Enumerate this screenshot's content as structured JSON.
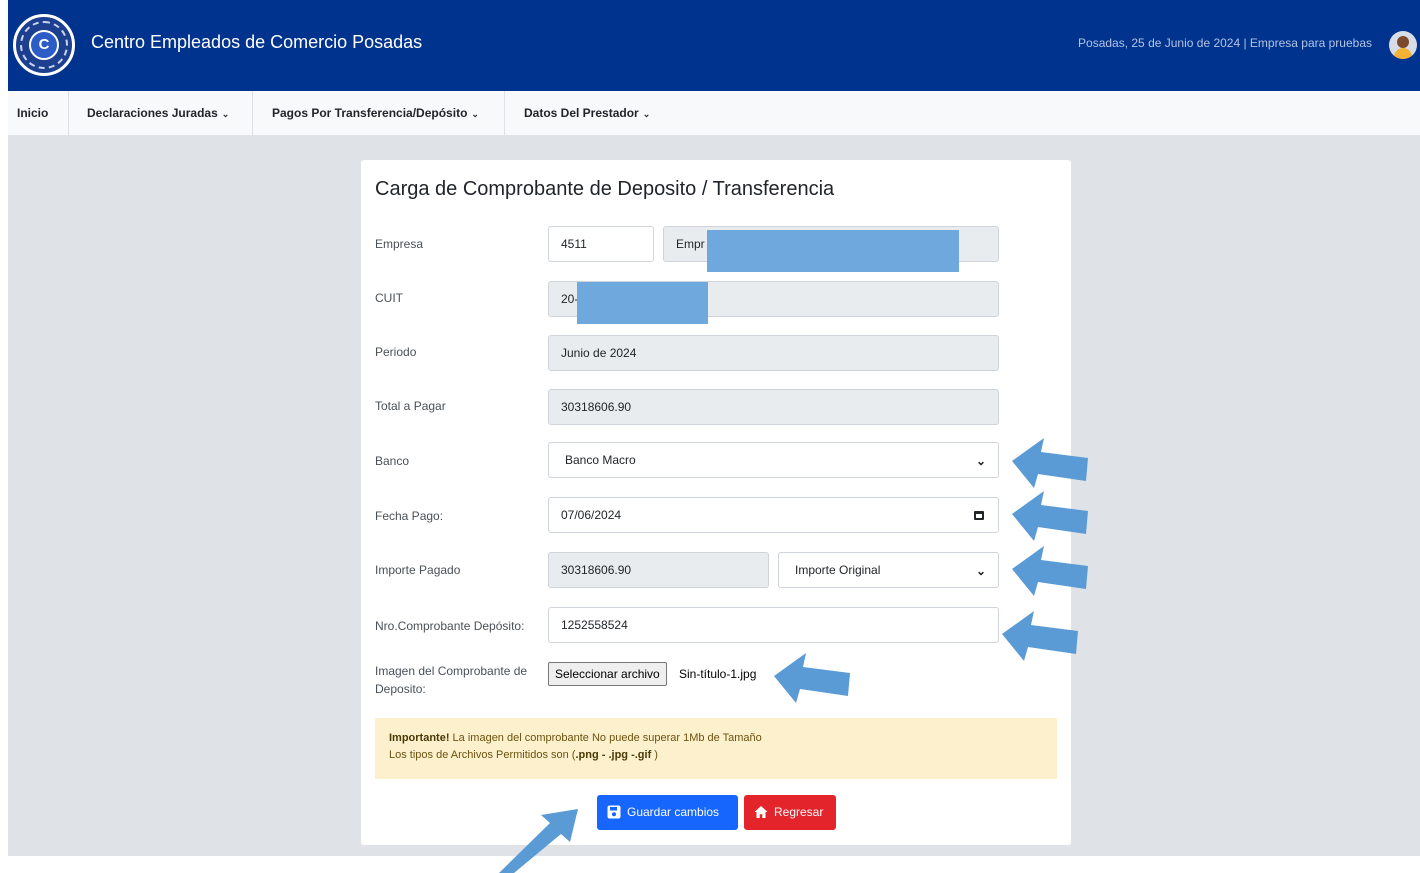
{
  "header": {
    "app_title": "Centro Empleados de Comercio Posadas",
    "info": "Posadas, 25 de Junio de 2024 | Empresa para pruebas",
    "logo": "cec-logo",
    "avatar": "user-avatar-icon",
    "color": "#00338d"
  },
  "nav": {
    "items": [
      {
        "label": "Inicio"
      },
      {
        "label": "Declaraciones Juradas"
      },
      {
        "label": "Pagos Por Transferencia/Depósito"
      },
      {
        "label": "Datos Del Prestador"
      }
    ],
    "caret": "⌄"
  },
  "form": {
    "title": "Carga de Comprobante de Deposito / Transferencia",
    "empresa": {
      "label": "Empresa",
      "code": "4511",
      "name": "Empr"
    },
    "cuit": {
      "label": "CUIT",
      "value": "20-"
    },
    "periodo": {
      "label": "Periodo",
      "value": "Junio de 2024"
    },
    "total": {
      "label": "Total a Pagar",
      "value": "30318606.90"
    },
    "banco": {
      "label": "Banco",
      "selected": "Banco Macro"
    },
    "fecha": {
      "label": "Fecha Pago:",
      "value": "07/06/2024"
    },
    "importe": {
      "label": "Importe Pagado",
      "value": "30318606.90",
      "type_selected": "Importe Original"
    },
    "nro": {
      "label": "Nro.Comprobante Depósito:",
      "value": "1252558524"
    },
    "imagen": {
      "label": "Imagen del Comprobante de Deposito:",
      "button": "Seleccionar archivo",
      "file": "Sin-título-1.jpg"
    },
    "alert": {
      "strong": "Importante!",
      "line1": " La imagen del comprobante No puede superar 1Mb de Tamaño",
      "line2_pre": "Los tipos de Archivos Permitidos son (",
      "line2_types": ".png - .jpg -.gif",
      "line2_post": " )"
    },
    "buttons": {
      "save": "Guardar cambios",
      "back": "Regresar"
    }
  },
  "colors": {
    "primary": "#1665fd",
    "danger": "#e3242b",
    "annotation": "#5b9bd5",
    "redaction": "#6fa8dc"
  }
}
